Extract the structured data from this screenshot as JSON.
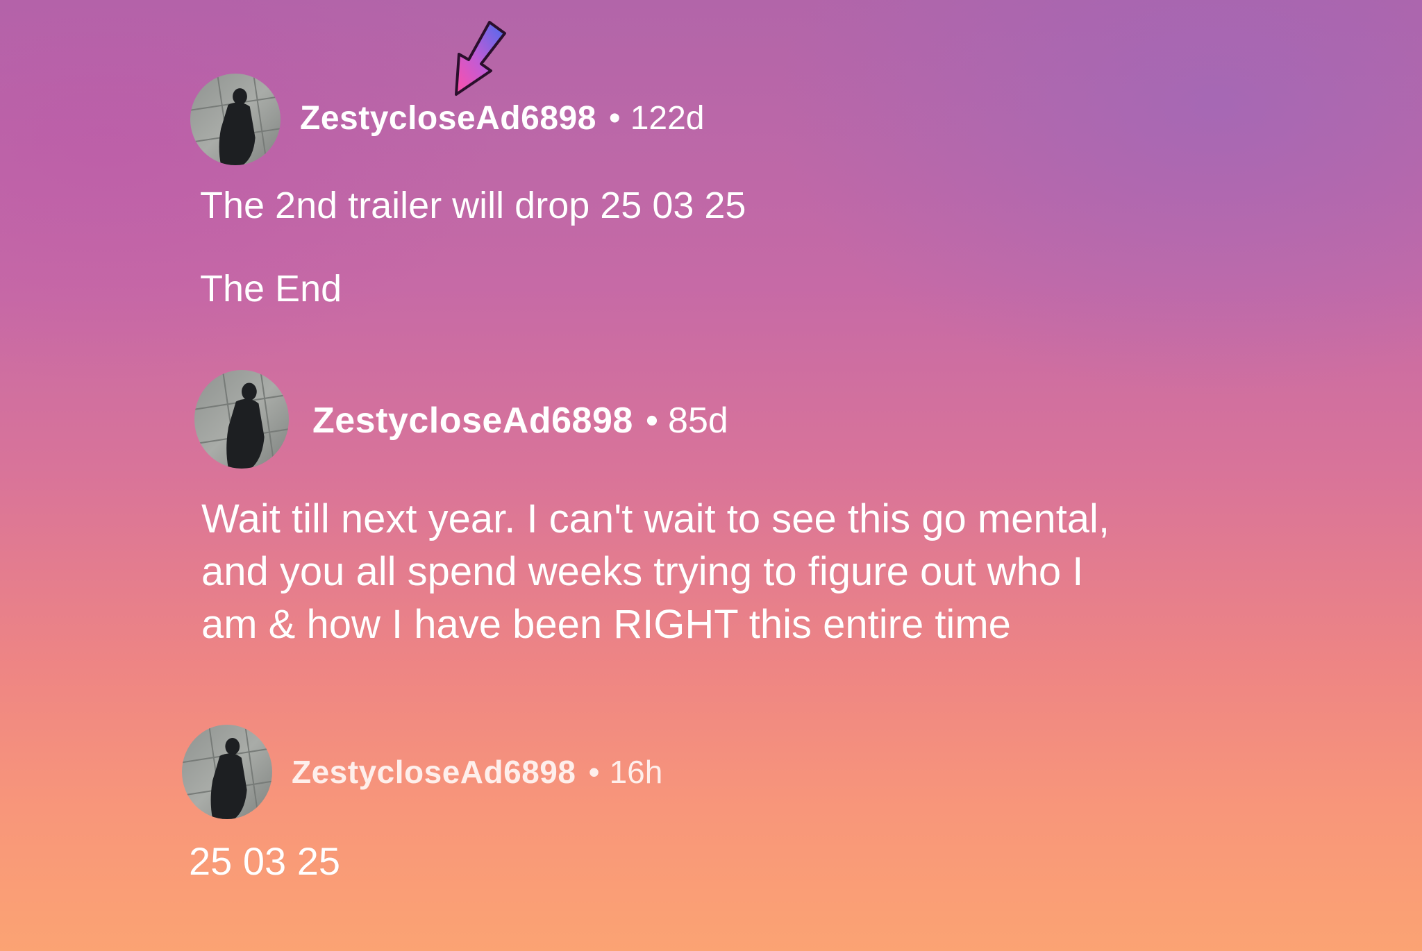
{
  "comments": [
    {
      "username": "ZestycloseAd6898",
      "separator": "•",
      "age": "122d",
      "body": [
        "The 2nd trailer will drop 25 03 25",
        "The End"
      ]
    },
    {
      "username": "ZestycloseAd6898",
      "separator": "•",
      "age": "85d",
      "body": [
        "Wait till next year. I can't wait to see this go mental,",
        "and you all spend weeks trying to figure out who I",
        "am & how I have been RIGHT this entire time"
      ]
    },
    {
      "username": "ZestycloseAd6898",
      "separator": "•",
      "age": "16h",
      "body": [
        "25 03 25"
      ]
    }
  ],
  "annotation": {
    "icon": "down-left-arrow-icon",
    "colors": [
      "#4a6cf0",
      "#ff4fa8"
    ]
  }
}
